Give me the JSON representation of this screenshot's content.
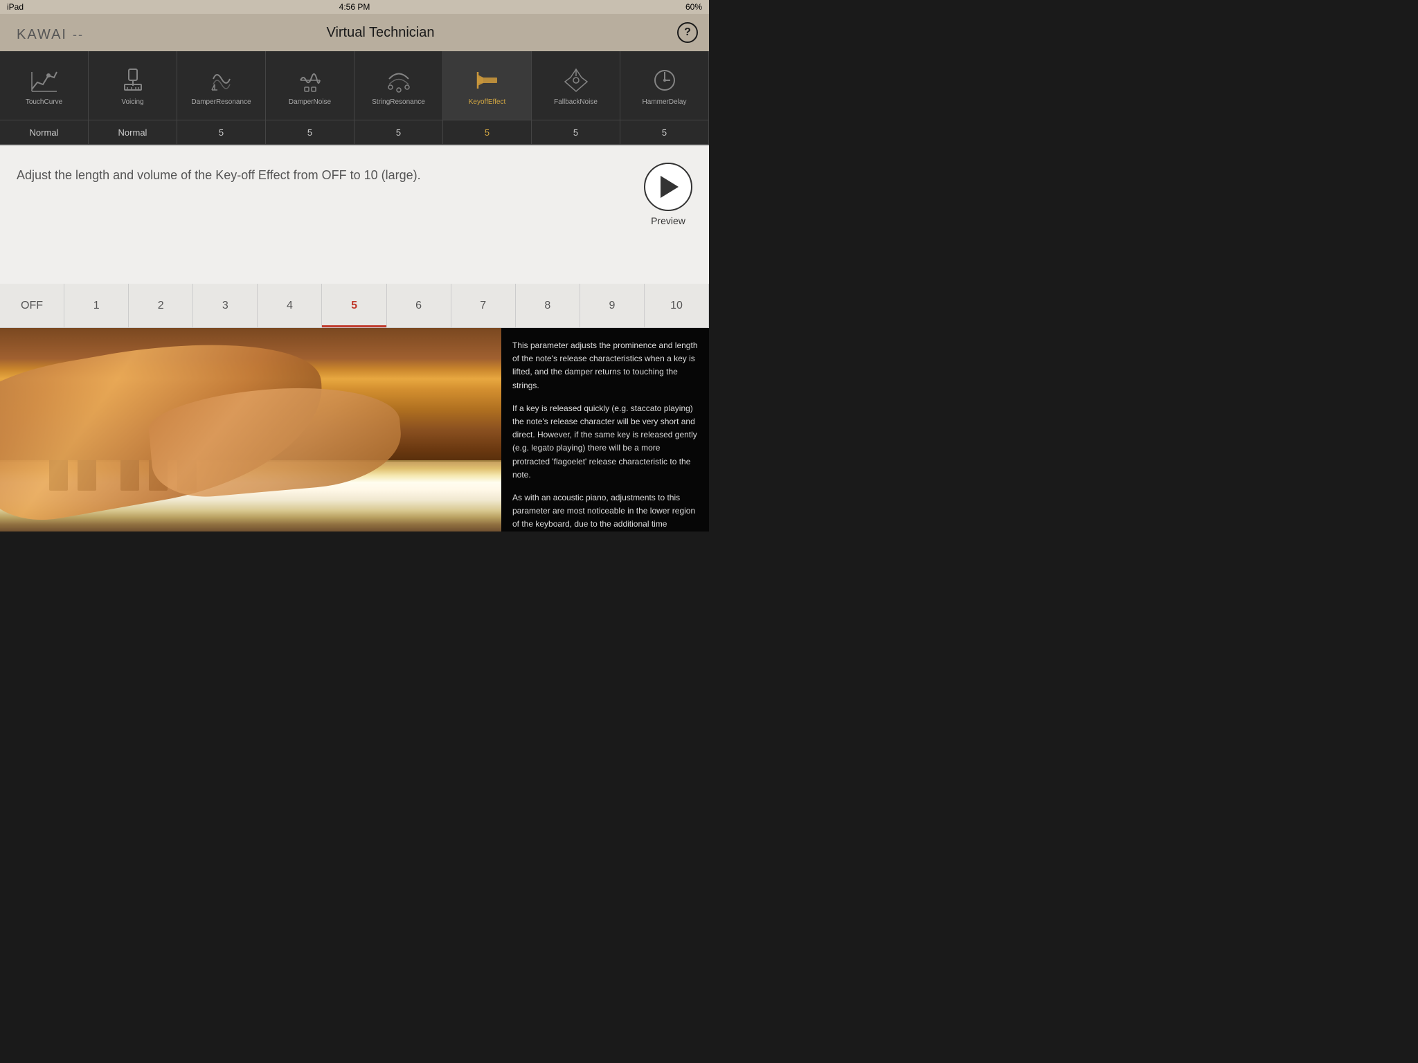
{
  "statusBar": {
    "device": "iPad",
    "time": "4:56 PM",
    "battery": "60%"
  },
  "header": {
    "logo": "KAWAI",
    "separator": "--",
    "title": "Virtual Technician",
    "helpLabel": "?"
  },
  "navTabs": [
    {
      "id": "touch-curve",
      "label": "TouchCurve",
      "value": "Normal",
      "active": false
    },
    {
      "id": "voicing",
      "label": "Voicing",
      "value": "Normal",
      "active": false
    },
    {
      "id": "damper-resonance",
      "label": "DamperResonance",
      "value": "5",
      "active": false
    },
    {
      "id": "damper-noise",
      "label": "DamperNoise",
      "value": "5",
      "active": false
    },
    {
      "id": "string-resonance",
      "label": "StringResonance",
      "value": "5",
      "active": false
    },
    {
      "id": "keyoff-effect",
      "label": "KeyoffEffect",
      "value": "5",
      "active": true
    },
    {
      "id": "fallback-noise",
      "label": "FallbackNoise",
      "value": "5",
      "active": false
    },
    {
      "id": "hammer-delay",
      "label": "HammerDelay",
      "value": "5",
      "active": false
    }
  ],
  "description": "Adjust the length and volume of the Key-off Effect from OFF to 10 (large).",
  "previewLabel": "Preview",
  "scaleItems": [
    {
      "label": "OFF",
      "value": "OFF",
      "active": false
    },
    {
      "label": "1",
      "value": "1",
      "active": false
    },
    {
      "label": "2",
      "value": "2",
      "active": false
    },
    {
      "label": "3",
      "value": "3",
      "active": false
    },
    {
      "label": "4",
      "value": "4",
      "active": false
    },
    {
      "label": "5",
      "value": "5",
      "active": true
    },
    {
      "label": "6",
      "value": "6",
      "active": false
    },
    {
      "label": "7",
      "value": "7",
      "active": false
    },
    {
      "label": "8",
      "value": "8",
      "active": false
    },
    {
      "label": "9",
      "value": "9",
      "active": false
    },
    {
      "label": "10",
      "value": "10",
      "active": false
    }
  ],
  "descriptionPanel": {
    "paragraph1": "This parameter adjusts the prominence and length of the note's release characteristics when a key is lifted, and the damper returns to touching the strings.",
    "paragraph2": "If a key is released quickly (e.g. staccato playing) the note's release character will be very short and direct. However, if the same key is released gently (e.g. legato playing) there will be a more protracted 'flagoelet' release characteristic to the note.",
    "paragraph3": "As with an acoustic piano, adjustments to this parameter are most noticeable in the lower region of the keyboard, due to the additional time required to damp the thicker, more powerful strings of bass notes."
  }
}
